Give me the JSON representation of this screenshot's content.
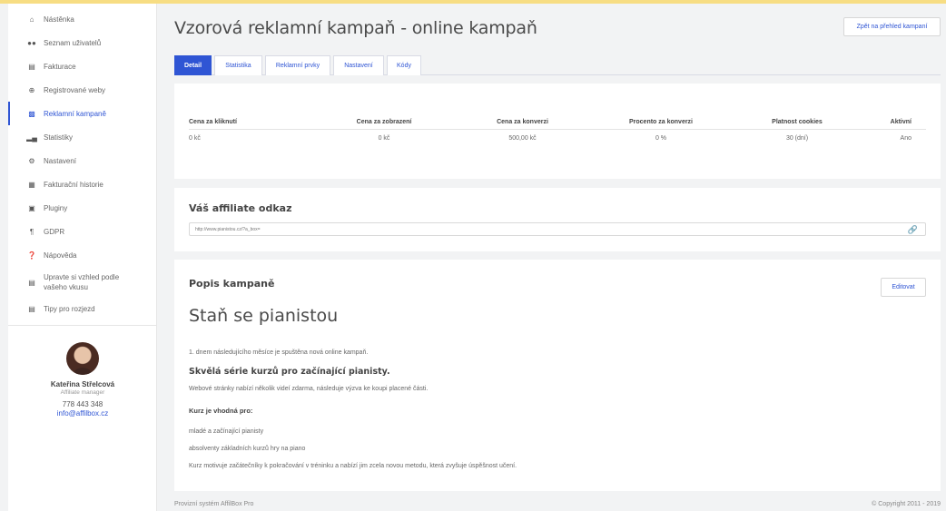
{
  "sidebar": {
    "items": [
      {
        "label": "Nástěnka",
        "icon": "home-icon"
      },
      {
        "label": "Seznam uživatelů",
        "icon": "users-icon"
      },
      {
        "label": "Fakturace",
        "icon": "invoice-icon"
      },
      {
        "label": "Registrované weby",
        "icon": "globe-icon"
      },
      {
        "label": "Reklamní kampaně",
        "icon": "campaign-icon"
      },
      {
        "label": "Statistiky",
        "icon": "bar-chart-icon"
      },
      {
        "label": "Nastavení",
        "icon": "gear-icon"
      },
      {
        "label": "Fakturační historie",
        "icon": "calendar-icon"
      },
      {
        "label": "Pluginy",
        "icon": "plugin-icon"
      },
      {
        "label": "GDPR",
        "icon": "paragraph-icon"
      },
      {
        "label": "Nápověda",
        "icon": "help-icon"
      },
      {
        "label": "Upravte si vzhled podle vašeho vkusu",
        "icon": "appearance-icon"
      },
      {
        "label": "Tipy pro rozjezd",
        "icon": "tips-icon"
      }
    ],
    "active_index": 4,
    "profile": {
      "name": "Kateřina Střelcová",
      "role": "Affiliate manager",
      "phone": "778 443 348",
      "email": "info@affilbox.cz"
    }
  },
  "header": {
    "title": "Vzorová reklamní kampaň - online kampaň",
    "back_button": "Zpět na přehled kampaní"
  },
  "tabs": [
    {
      "label": "Detail",
      "active": true
    },
    {
      "label": "Statistika",
      "active": false
    },
    {
      "label": "Reklamní prvky",
      "active": false
    },
    {
      "label": "Nastavení",
      "active": false
    },
    {
      "label": "Kódy",
      "active": false
    }
  ],
  "stats_table": {
    "headers": [
      "Cena za kliknutí",
      "Cena za zobrazení",
      "Cena za konverzi",
      "Procento za konverzi",
      "Platnost cookies",
      "Aktivní"
    ],
    "row": [
      "0 kč",
      "0 kč",
      "500,00 kč",
      "0 %",
      "30 (dní)",
      "Ano"
    ]
  },
  "affiliate": {
    "heading": "Váš affiliate odkaz",
    "link": "http://www.pianistou.cz/?a_box="
  },
  "description": {
    "heading": "Popis kampaně",
    "edit_button": "Editovat",
    "title": "Staň se pianistou",
    "line1": "1. dnem následujícího měsíce je spuštěna nová online kampaň.",
    "subheading": "Skvělá série kurzů pro začínající pianisty.",
    "line2": "Webové stránky nabízí několik videí zdarma, následuje výzva ke koupi placené části.",
    "suitable_heading": "Kurz je vhodná pro:",
    "bullet1": "mladé a začínající pianisty",
    "bullet2": "absolventy základních kurzů hry na piano",
    "line3": "Kurz motivuje začátečníky k pokračování v tréninku a nabízí jim zcela novou  metodu, která zvyšuje úspěšnost učení."
  },
  "footer": {
    "left": "Provizní systém AffilBox Pro",
    "right": "© Copyright 2011 - 2019"
  },
  "colors": {
    "accent": "#2f55d4",
    "top_line": "#f7dd83"
  }
}
